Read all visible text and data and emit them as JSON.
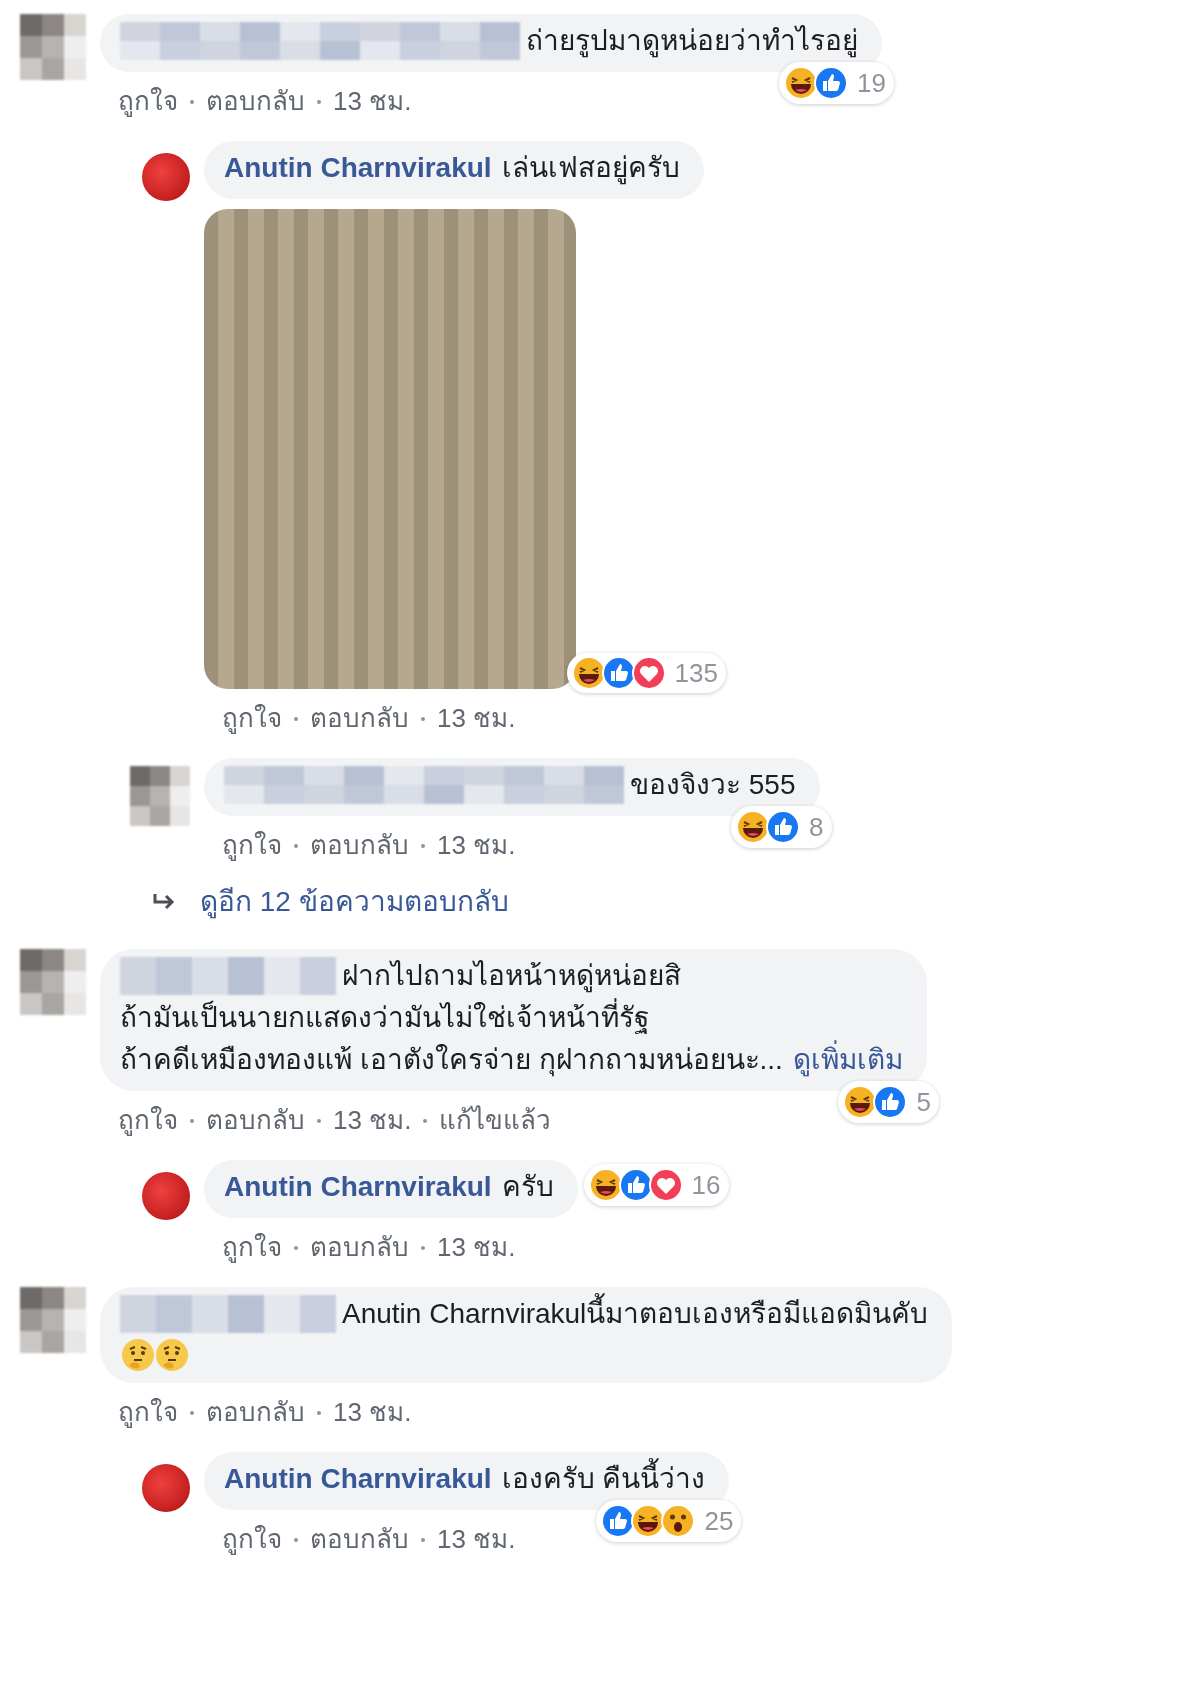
{
  "comments": [
    {
      "kind": "top",
      "author": {
        "kind": "blurred"
      },
      "lines": [
        "ถ่ายรูปมาดูหน่อยว่าทำไรอยู่"
      ],
      "reactions": {
        "icons": [
          {
            "kind": "haha"
          },
          {
            "kind": "like"
          }
        ],
        "count": "19"
      },
      "actions": [
        "ถูกใจ",
        "ตอบกลับ",
        "13 ชม."
      ]
    },
    {
      "kind": "reply",
      "author": {
        "kind": "named",
        "name": "Anutin Charnvirakul"
      },
      "lines": [
        "เล่นเฟสอยู่ครับ"
      ],
      "photo": true,
      "reactions": {
        "icons": [
          {
            "kind": "haha"
          },
          {
            "kind": "like"
          },
          {
            "kind": "love"
          }
        ],
        "count": "135"
      },
      "actions": [
        "ถูกใจ",
        "ตอบกลับ",
        "13 ชม."
      ]
    },
    {
      "kind": "reply",
      "author": {
        "kind": "blurred"
      },
      "lines": [
        "ของจิงวะ 555"
      ],
      "reactions": {
        "icons": [
          {
            "kind": "haha"
          },
          {
            "kind": "like"
          }
        ],
        "count": "8"
      },
      "actions": [
        "ถูกใจ",
        "ตอบกลับ",
        "13 ชม."
      ]
    },
    {
      "kind": "more",
      "label": "ดูอีก 12 ข้อความตอบกลับ"
    },
    {
      "kind": "top",
      "author": {
        "kind": "blurred"
      },
      "lines": [
        "ฝากไปถามไอหน้าหดู่หน่อยสิ",
        "ถ้ามันเป็นนายกแสดงว่ามันไม่ใช่เจ้าหน้าที่รัฐ",
        "ถ้าคดีเหมืองทองแพ้ เอาตังใครจ่าย กุฝากถามหน่อยนะ..."
      ],
      "see_more": "ดูเพิ่มเติม",
      "reactions": {
        "icons": [
          {
            "kind": "haha"
          },
          {
            "kind": "like"
          }
        ],
        "count": "5"
      },
      "actions": [
        "ถูกใจ",
        "ตอบกลับ",
        "13 ชม.",
        "แก้ไขแล้ว"
      ]
    },
    {
      "kind": "reply",
      "author": {
        "kind": "named",
        "name": "Anutin Charnvirakul"
      },
      "lines": [
        "ครับ"
      ],
      "reactions": {
        "icons": [
          {
            "kind": "haha"
          },
          {
            "kind": "like"
          },
          {
            "kind": "love"
          }
        ],
        "count": "16"
      },
      "actions": [
        "ถูกใจ",
        "ตอบกลับ",
        "13 ชม."
      ]
    },
    {
      "kind": "top",
      "author": {
        "kind": "blurred"
      },
      "lines": [
        "Anutin Charnvirakulนี้มาตอบเองหรือมีแอดมินคับ"
      ],
      "emojis": [
        {
          "kind": "thinking"
        },
        {
          "kind": "thinking"
        }
      ],
      "actions": [
        "ถูกใจ",
        "ตอบกลับ",
        "13 ชม."
      ]
    },
    {
      "kind": "reply",
      "author": {
        "kind": "named",
        "name": "Anutin Charnvirakul"
      },
      "lines": [
        "เองครับ คืนนี้ว่าง"
      ],
      "reactions": {
        "icons": [
          {
            "kind": "like"
          },
          {
            "kind": "haha"
          },
          {
            "kind": "wow"
          }
        ],
        "count": "25"
      },
      "actions": [
        "ถูกใจ",
        "ตอบกลับ",
        "13 ชม."
      ]
    }
  ]
}
